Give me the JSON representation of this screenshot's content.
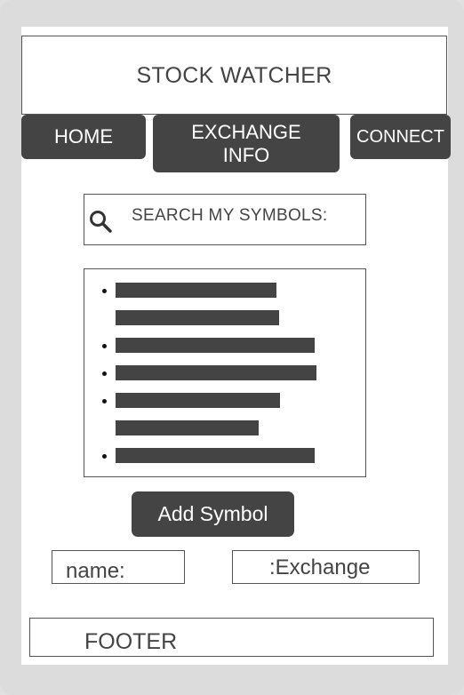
{
  "header": {
    "title": "STOCK WATCHER"
  },
  "nav": {
    "home": "HOME",
    "exchange_line1": "EXCHANGE",
    "exchange_line2": "INFO",
    "connect": "CONNECT"
  },
  "search": {
    "label": "SEARCH MY SYMBOLS:",
    "icon": "search-icon"
  },
  "symbol_list": {
    "items": [
      {
        "lines": 2
      },
      {
        "lines": 1
      },
      {
        "lines": 1
      },
      {
        "lines": 2
      },
      {
        "lines": 1
      }
    ]
  },
  "actions": {
    "add_symbol": "Add Symbol"
  },
  "fields": {
    "name_label": "name:",
    "exchange_label": ":Exchange"
  },
  "footer": {
    "label": "FOOTER"
  },
  "colors": {
    "dark": "#444444",
    "frame": "#dcdcdc",
    "border": "#555555"
  }
}
